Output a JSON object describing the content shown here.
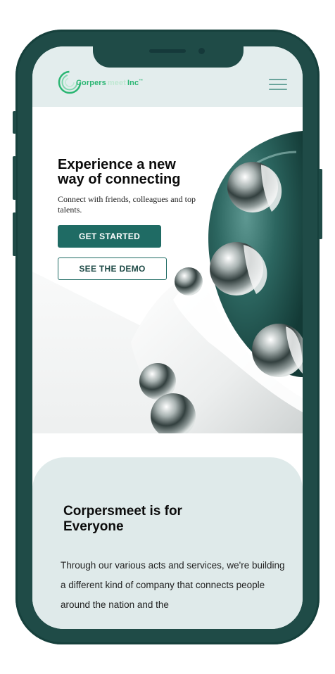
{
  "header": {
    "logo_text_primary": "Corpers",
    "logo_text_faint": "meet",
    "logo_text_suffix": "Inc",
    "menu_icon": "hamburger-menu-icon"
  },
  "hero": {
    "title": "Experience a new way of connecting",
    "subtitle": "Connect with friends, colleagues and top talents.",
    "primary_button": "GET STARTED",
    "secondary_button": "SEE THE DEMO"
  },
  "section": {
    "title": "Corpersmeet is for Everyone",
    "body": "Through our various acts and services, we're building a different kind of company that connects people around the nation and the"
  },
  "colors": {
    "frame": "#1f4b47",
    "accent": "#1f6b64",
    "header_bg": "#e3eded",
    "section_bg": "#dfeaea",
    "logo_green": "#2bb673"
  }
}
